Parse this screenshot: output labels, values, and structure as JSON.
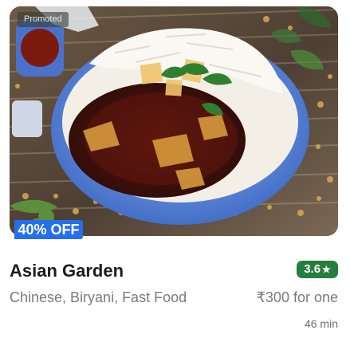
{
  "card": {
    "promoted_label": "Promoted",
    "discount_label": "40% OFF",
    "restaurant_name": "Asian Garden",
    "rating": "3.6",
    "rating_star_icon": "star-icon",
    "cuisines": "Chinese, Biryani, Fast Food",
    "price": "₹300 for one",
    "delivery_time": "46 min",
    "colors": {
      "discount_blue": "#256fef",
      "rating_green": "#267e3e",
      "title": "#1c1c1c",
      "secondary_text": "#7a7a7a"
    }
  }
}
